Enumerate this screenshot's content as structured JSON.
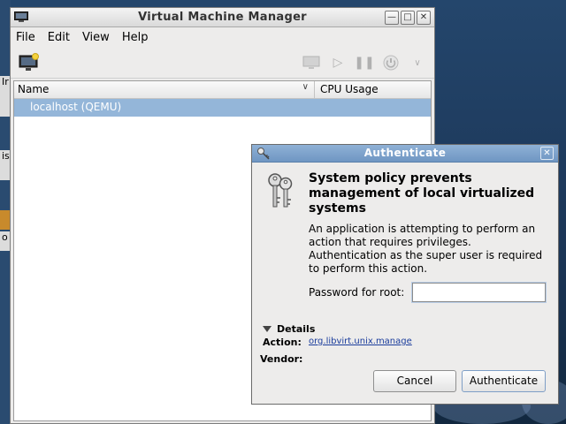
{
  "vmm": {
    "title": "Virtual Machine Manager",
    "menu": [
      "File",
      "Edit",
      "View",
      "Help"
    ],
    "columns": {
      "name": "Name",
      "cpu": "CPU Usage"
    },
    "rows": [
      "localhost (QEMU)"
    ]
  },
  "left_strip": {
    "frag1": "Ir",
    "frag2": "is",
    "frag3": "o"
  },
  "auth": {
    "title": "Authenticate",
    "heading": "System policy prevents management of local virtualized systems",
    "body": "An application is attempting to perform an action that requires privileges. Authentication as the super user is required to perform this action.",
    "password_label": "Password for root:",
    "password_value": "",
    "details_label": "Details",
    "action_label": "Action:",
    "action_value": "org.libvirt.unix.manage",
    "vendor_label": "Vendor:",
    "cancel_label": "Cancel",
    "authenticate_label": "Authenticate"
  },
  "colors": {
    "selection": "#94b6d9",
    "dialog_titlebar": "#7aa0cb",
    "link": "#1a3c9c",
    "desktop": "#1f3c5e"
  },
  "icons": {
    "vmm_window": "monitor-icon",
    "new_vm": "new-vm-icon",
    "console": "console-icon",
    "run": "play-icon",
    "pause": "pause-icon",
    "shutdown": "power-icon",
    "shutdown_menu": "chevron-down-icon",
    "dialog_small": "key-icon",
    "dialog_large": "keys-icon"
  }
}
